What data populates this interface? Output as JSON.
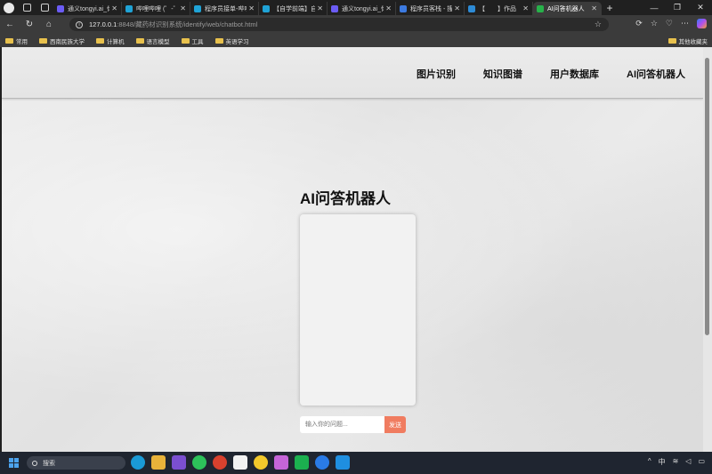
{
  "browser": {
    "tabs": [
      {
        "label": "通义tongyi.ai_你的",
        "color": "#6b5cf5"
      },
      {
        "label": "哔哩哔哩 (゜-゜)つ",
        "color": "#1fa3d6"
      },
      {
        "label": "程序员接单-哔哩",
        "color": "#1fa3d6"
      },
      {
        "label": "【自学前端】自动",
        "color": "#1fa3d6"
      },
      {
        "label": "通义tongyi.ai_你的",
        "color": "#6b5cf5"
      },
      {
        "label": "程序员客栈 - 搜索",
        "color": "#3c7ae0"
      },
      {
        "label": "【　　】作品",
        "color": "#2d8bd6"
      },
      {
        "label": "AI问答机器人",
        "color": "#27b14a",
        "active": true
      }
    ],
    "url_host": "127.0.0.1",
    "url_path": ":8848/藏药材识别系统/identify/web/chatbot.html",
    "bookmarks": [
      "常用",
      "西南民族大学",
      "计算机",
      "语言模型",
      "工具",
      "英语学习"
    ],
    "other_bookmarks": "其他收藏夹"
  },
  "page": {
    "nav": [
      "图片识别",
      "知识图谱",
      "用户数据库",
      "AI问答机器人"
    ],
    "chat_title": "AI问答机器人",
    "input_placeholder": "输入你的问题...",
    "send_label": "发送"
  },
  "taskbar": {
    "search_label": "搜索",
    "ime": "中"
  }
}
